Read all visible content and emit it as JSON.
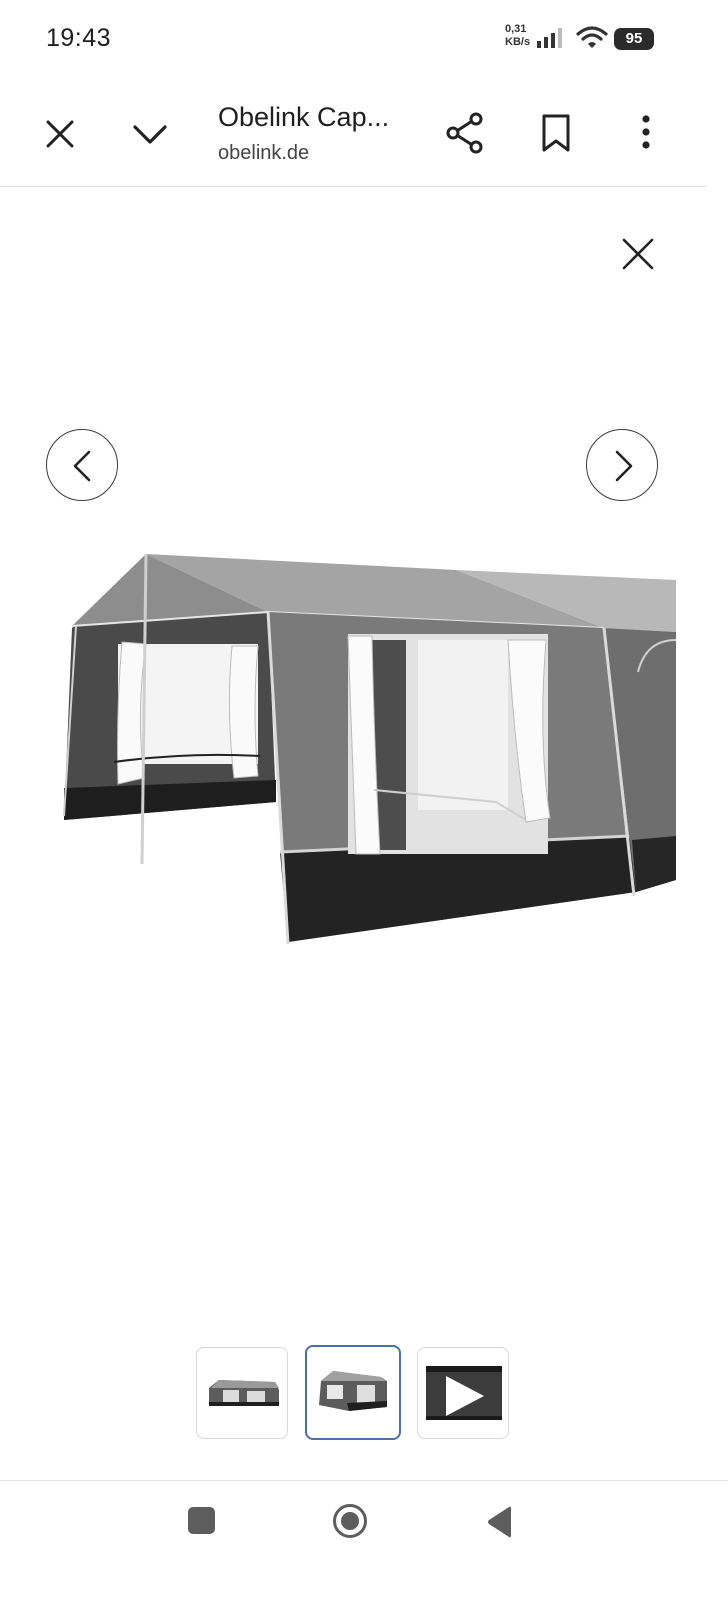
{
  "status_bar": {
    "time": "19:43",
    "net_speed_value": "0,31",
    "net_speed_unit": "KB/s",
    "battery": "95",
    "icons": [
      "signal-icon",
      "wifi-icon",
      "battery-icon"
    ]
  },
  "toolbar": {
    "title": "Obelink Cap...",
    "domain": "obelink.de",
    "icons": [
      "close-icon",
      "chevron-down-icon",
      "share-icon",
      "bookmark-icon",
      "more-vert-icon"
    ]
  },
  "viewer": {
    "icons": [
      "close-icon",
      "chevron-left-icon",
      "chevron-right-icon"
    ],
    "image": "awning-tent-photo",
    "thumbnails": [
      {
        "kind": "image",
        "selected": false
      },
      {
        "kind": "image",
        "selected": true
      },
      {
        "kind": "video",
        "selected": false
      }
    ],
    "selected_color": "#4a6fb3"
  },
  "system_nav": {
    "icons": [
      "recents-square-icon",
      "home-circle-icon",
      "back-triangle-icon"
    ]
  }
}
